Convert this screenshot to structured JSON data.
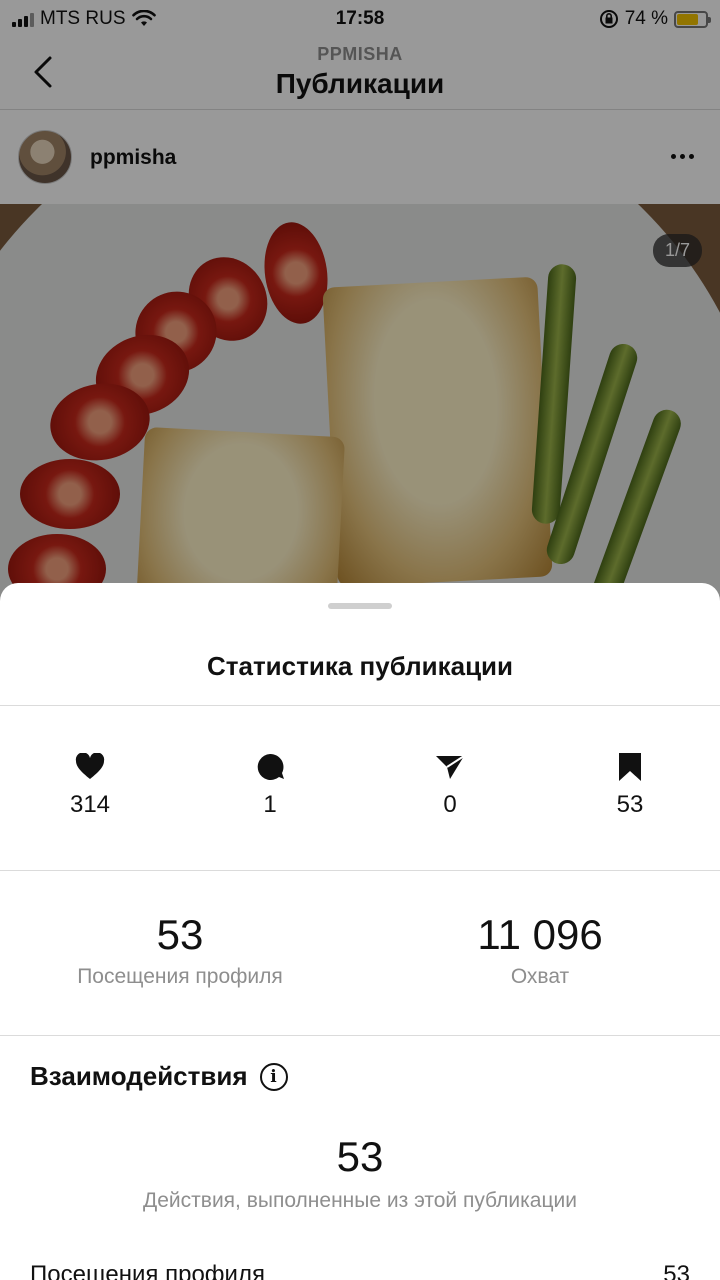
{
  "status_bar": {
    "carrier": "MTS RUS",
    "time": "17:58",
    "battery_percent": "74 %",
    "battery_level": 0.74,
    "battery_color": "#f3c400"
  },
  "nav": {
    "subtitle": "PPMISHA",
    "title": "Публикации",
    "back_icon": "chevron-left-icon"
  },
  "post": {
    "username": "ppmisha",
    "photo_counter": "1/7",
    "more_icon": "ellipsis-icon"
  },
  "sheet": {
    "title": "Статистика публикации",
    "counts": [
      {
        "icon": "heart-icon",
        "value": "314"
      },
      {
        "icon": "comment-icon",
        "value": "1"
      },
      {
        "icon": "send-icon",
        "value": "0"
      },
      {
        "icon": "bookmark-icon",
        "value": "53"
      }
    ],
    "metrics": [
      {
        "value": "53",
        "label": "Посещения профиля"
      },
      {
        "value": "11 096",
        "label": "Охват"
      }
    ],
    "interactions": {
      "title": "Взаимодействия",
      "info_icon": "info-icon",
      "value": "53",
      "label": "Действия, выполненные из этой публикации",
      "rows": [
        {
          "label": "Посещения профиля",
          "value": "53"
        }
      ]
    }
  }
}
